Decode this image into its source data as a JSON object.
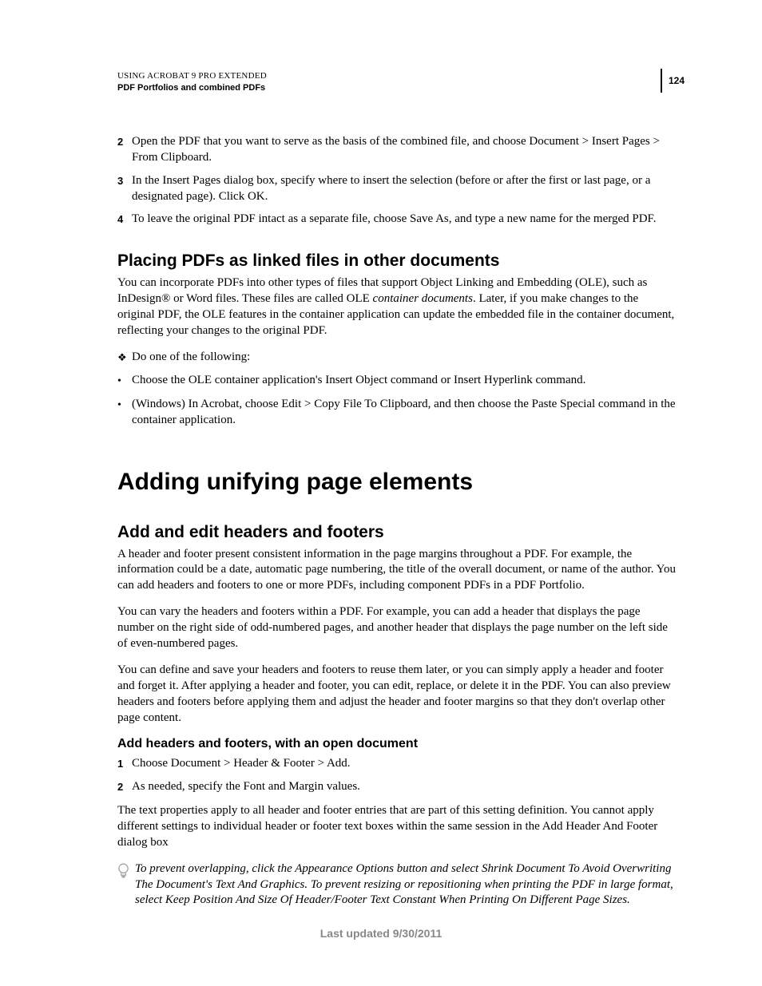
{
  "header": {
    "line1": "USING ACROBAT 9 PRO EXTENDED",
    "line2": "PDF Portfolios and combined PDFs",
    "page_number": "124"
  },
  "steps_top": [
    {
      "num": "2",
      "text": "Open the PDF that you want to serve as the basis of the combined file, and choose Document > Insert Pages > From Clipboard."
    },
    {
      "num": "3",
      "text": "In the Insert Pages dialog box, specify where to insert the selection (before or after the first or last page, or a designated page). Click OK."
    },
    {
      "num": "4",
      "text": "To leave the original PDF intact as a separate file, choose Save As, and type a new name for the merged PDF."
    }
  ],
  "section_placing": {
    "heading": "Placing PDFs as linked files in other documents",
    "para_prefix": "You can incorporate PDFs into other types of files that support Object Linking and Embedding (OLE), such as InDesign® or Word files. These files are called OLE ",
    "para_italic": "container documents",
    "para_suffix": ". Later, if you make changes to the original PDF, the OLE features in the container application can update the embedded file in the container document, reflecting your changes to the original PDF.",
    "do_one": "Do one of the following:",
    "bullets": [
      "Choose the OLE container application's Insert Object command or Insert Hyperlink command.",
      "(Windows) In Acrobat, choose Edit > Copy File To Clipboard, and then choose the Paste Special command in the container application."
    ]
  },
  "section_adding": {
    "h1": "Adding unifying page elements",
    "h2": "Add and edit headers and footers",
    "paras": [
      "A header and footer present consistent information in the page margins throughout a PDF. For example, the information could be a date, automatic page numbering, the title of the overall document, or name of the author. You can add headers and footers to one or more PDFs, including component PDFs in a PDF Portfolio.",
      "You can vary the headers and footers within a PDF. For example, you can add a header that displays the page number on the right side of odd-numbered pages, and another header that displays the page number on the left side of even-numbered pages.",
      "You can define and save your headers and footers to reuse them later, or you can simply apply a header and footer and forget it. After applying a header and footer, you can edit, replace, or delete it in the PDF. You can also preview headers and footers before applying them and adjust the header and footer margins so that they don't overlap other page content."
    ],
    "h3": "Add headers and footers, with an open document",
    "steps": [
      {
        "num": "1",
        "text": "Choose Document > Header & Footer > Add."
      },
      {
        "num": "2",
        "text": "As needed, specify the Font and Margin values."
      }
    ],
    "para_after_steps": "The text properties apply to all header and footer entries that are part of this setting definition. You cannot apply different settings to individual header or footer text boxes within the same session in the Add Header And Footer dialog box",
    "tip": "To prevent overlapping, click the Appearance Options button and select Shrink Document To Avoid Overwriting The Document's Text And Graphics. To prevent resizing or repositioning when printing the PDF in large format, select Keep Position And Size Of Header/Footer Text Constant When Printing On Different Page Sizes."
  },
  "footer": "Last updated 9/30/2011"
}
